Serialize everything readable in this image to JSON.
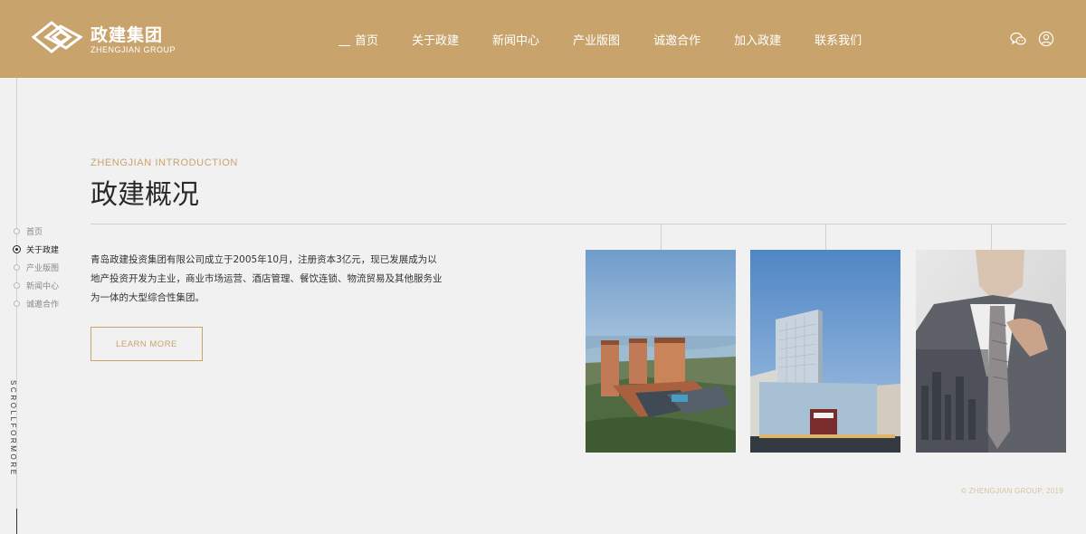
{
  "brand": {
    "name_cn": "政建集团",
    "name_en": "ZHENGJIAN GROUP",
    "color": "#c8a46c"
  },
  "nav": [
    {
      "label": "首页",
      "active": true
    },
    {
      "label": "关于政建",
      "active": false
    },
    {
      "label": "新闻中心",
      "active": false
    },
    {
      "label": "产业版图",
      "active": false
    },
    {
      "label": "诚邀合作",
      "active": false
    },
    {
      "label": "加入政建",
      "active": false
    },
    {
      "label": "联系我们",
      "active": false
    }
  ],
  "header_icons": [
    "wechat-icon",
    "user-icon"
  ],
  "side_nav": [
    {
      "label": "首页",
      "active": false
    },
    {
      "label": "关于政建",
      "active": true
    },
    {
      "label": "产业版图",
      "active": false
    },
    {
      "label": "新闻中心",
      "active": false
    },
    {
      "label": "诚邀合作",
      "active": false
    }
  ],
  "scroll_hint": "SCROLLFORMORE",
  "section": {
    "eyebrow": "ZHENGJIAN INTRODUCTION",
    "title": "政建概况",
    "intro": "青岛政建投资集团有限公司成立于2005年10月，注册资本3亿元，现已发展成为以地产投资开发为主业，商业市场运营、酒店管理、餐饮连锁、物流贸易及其他服务业为一体的大型综合性集团。",
    "button": "LEARN MORE"
  },
  "photos": [
    {
      "name": "photo-waterfront-hotel"
    },
    {
      "name": "photo-office-tower"
    },
    {
      "name": "photo-businessman"
    }
  ],
  "copyright": "© ZHENGJIAN GROUP, 2019"
}
